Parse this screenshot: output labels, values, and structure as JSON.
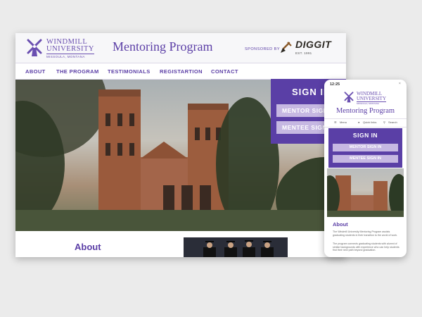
{
  "desktop": {
    "logo": {
      "name1": "WINDMILL",
      "name2": "UNIVERSITY",
      "location": "MISSOULA, MONTANA"
    },
    "title": "Mentoring Program",
    "sponsor": {
      "label": "SPONSORED BY",
      "brand": "DIGGIT",
      "est": "EST. 1991"
    },
    "nav": [
      "ABOUT",
      "THE PROGRAM",
      "TESTIMONIALS",
      "REGISTARTION",
      "CONTACT"
    ],
    "signin": {
      "title": "SIGN IN",
      "mentor": "MENTOR SIGN IN",
      "mentee": "MENTEE SIGN IN"
    },
    "about": "About"
  },
  "mobile": {
    "status_time": "12:25",
    "close": "×",
    "logo": {
      "name1": "WINDMILL",
      "name2": "UNIVERSITY",
      "location": "MISSOULA, MONTANA"
    },
    "title": "Mentoring Program",
    "nav": [
      "Menu",
      "Quick links",
      "Search"
    ],
    "signin": {
      "title": "SIGN IN",
      "mentor": "MENTOR SIGN IN",
      "mentee": "MENTEE SIGN IN"
    },
    "about": "About",
    "para1": "The Windmill University Mentoring Program assists graduating students in their transition to the world of work.",
    "para2": "The program connects graduating students with alumni of similar backgrounds with experience who can help students find their next path beyond graduation."
  },
  "colors": {
    "brand": "#5b3ea6",
    "button": "#c6b8e2",
    "signin_bg": "#5a3fa6"
  },
  "icons": [
    "windmill-icon",
    "shovel-icon",
    "menu-icon",
    "quick-links-icon",
    "search-icon"
  ]
}
